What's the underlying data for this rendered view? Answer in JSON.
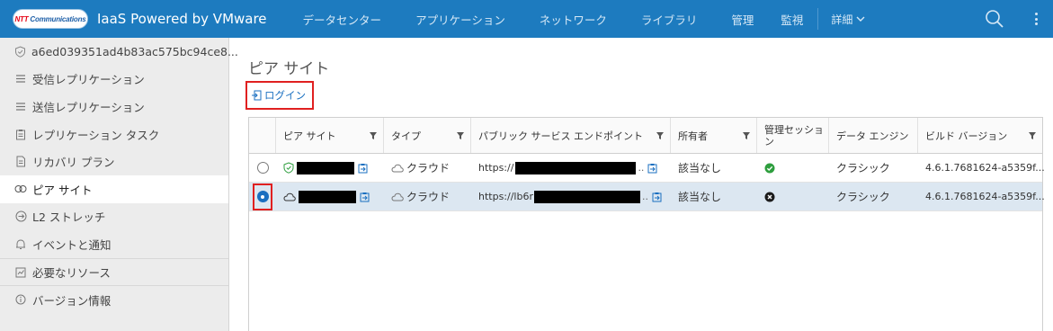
{
  "header": {
    "logo_text": "NTT Communications",
    "title": "IaaS Powered by VMware",
    "nav": [
      "データセンター",
      "アプリケーション",
      "ネットワーク",
      "ライブラリ",
      "管理",
      "監視"
    ],
    "more_label": "詳細",
    "bg_color": "#1d7bbf"
  },
  "sidebar": {
    "items": [
      {
        "label": "a6ed039351ad4b83ac575bc94ce8...",
        "icon": "shield-check-icon"
      },
      {
        "label": "受信レプリケーション",
        "icon": "list-icon"
      },
      {
        "label": "送信レプリケーション",
        "icon": "list-icon"
      },
      {
        "label": "レプリケーション タスク",
        "icon": "clipboard-icon"
      },
      {
        "label": "リカバリ プラン",
        "icon": "document-icon"
      },
      {
        "label": "ピア サイト",
        "icon": "peer-sites-icon",
        "active": true
      },
      {
        "label": "L2 ストレッチ",
        "icon": "stretch-icon"
      },
      {
        "label": "イベントと通知",
        "icon": "bell-icon"
      },
      {
        "label": "必要なリソース",
        "icon": "chart-icon"
      },
      {
        "label": "バージョン情報",
        "icon": "info-icon"
      }
    ]
  },
  "main": {
    "title": "ピア サイト",
    "login_label": "ログイン",
    "grid": {
      "columns": [
        "ピア サイト",
        "タイプ",
        "パブリック サービス エンドポイント",
        "所有者",
        "管理セッション",
        "データ エンジン",
        "ビルド バージョン"
      ],
      "rows": [
        {
          "selected": false,
          "type": "クラウド",
          "endpoint": "https://",
          "owner": "該当なし",
          "session_ok": true,
          "engine": "クラシック",
          "build": "4.6.1.7681624-a5359f..."
        },
        {
          "selected": true,
          "type": "クラウド",
          "endpoint": "https://lb6r",
          "owner": "該当なし",
          "session_ok": false,
          "engine": "クラシック",
          "build": "4.6.1.7681624-a5359f..."
        }
      ]
    }
  },
  "colors": {
    "accent": "#1a6fc0",
    "highlight_box": "#e02020",
    "ok": "#2e9e3e",
    "selected_row": "#dce7f1"
  }
}
